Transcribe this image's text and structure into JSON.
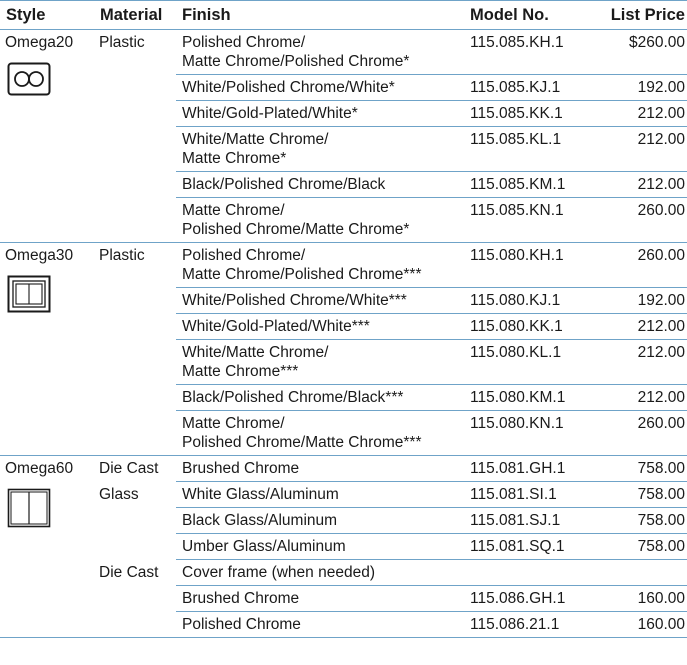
{
  "headers": {
    "style": "Style",
    "material": "Material",
    "finish": "Finish",
    "model": "Model No.",
    "price": "List Price"
  },
  "groups": [
    {
      "style": "Omega20",
      "icon": "omega20-two-circle-button-icon",
      "rows": [
        {
          "material": "Plastic",
          "finish": [
            "Polished Chrome/",
            "Matte Chrome/Polished Chrome*"
          ],
          "model": "115.085.KH.1",
          "price": "$260.00"
        },
        {
          "material": "",
          "finish": [
            "White/Polished Chrome/White*"
          ],
          "model": "115.085.KJ.1",
          "price": "192.00"
        },
        {
          "material": "",
          "finish": [
            "White/Gold-Plated/White*"
          ],
          "model": "115.085.KK.1",
          "price": "212.00"
        },
        {
          "material": "",
          "finish": [
            "White/Matte Chrome/",
            "Matte Chrome*"
          ],
          "model": "115.085.KL.1",
          "price": "212.00"
        },
        {
          "material": "",
          "finish": [
            "Black/Polished Chrome/Black"
          ],
          "model": "115.085.KM.1",
          "price": "212.00"
        },
        {
          "material": "",
          "finish": [
            "Matte Chrome/",
            "Polished Chrome/Matte Chrome*"
          ],
          "model": "115.085.KN.1",
          "price": "260.00"
        }
      ]
    },
    {
      "style": "Omega30",
      "icon": "omega30-dual-rectangle-button-icon",
      "rows": [
        {
          "material": "Plastic",
          "finish": [
            "Polished Chrome/",
            "Matte Chrome/Polished Chrome***"
          ],
          "model": "115.080.KH.1",
          "price": "260.00"
        },
        {
          "material": "",
          "finish": [
            "White/Polished Chrome/White***"
          ],
          "model": "115.080.KJ.1",
          "price": "192.00"
        },
        {
          "material": "",
          "finish": [
            "White/Gold-Plated/White***"
          ],
          "model": "115.080.KK.1",
          "price": "212.00"
        },
        {
          "material": "",
          "finish": [
            "White/Matte Chrome/",
            "Matte Chrome***"
          ],
          "model": "115.080.KL.1",
          "price": "212.00"
        },
        {
          "material": "",
          "finish": [
            "Black/Polished Chrome/Black***"
          ],
          "model": "115.080.KM.1",
          "price": "212.00"
        },
        {
          "material": "",
          "finish": [
            "Matte Chrome/",
            "Polished Chrome/Matte Chrome***"
          ],
          "model": "115.080.KN.1",
          "price": "260.00"
        }
      ]
    },
    {
      "style": "Omega60",
      "icon": "omega60-split-panel-icon",
      "rows": [
        {
          "material": "Die Cast",
          "finish": [
            "Brushed Chrome"
          ],
          "model": "115.081.GH.1",
          "price": "758.00"
        },
        {
          "material": "Glass",
          "finish": [
            "White Glass/Aluminum"
          ],
          "model": "115.081.SI.1",
          "price": "758.00"
        },
        {
          "material": "",
          "finish": [
            "Black Glass/Aluminum"
          ],
          "model": "115.081.SJ.1",
          "price": "758.00"
        },
        {
          "material": "",
          "finish": [
            "Umber Glass/Aluminum"
          ],
          "model": "115.081.SQ.1",
          "price": "758.00"
        },
        {
          "material": "Die Cast",
          "finish": [
            "Cover frame (when needed)"
          ],
          "model": "",
          "price": ""
        },
        {
          "material": "",
          "finish": [
            "Brushed Chrome"
          ],
          "model": "115.086.GH.1",
          "price": "160.00"
        },
        {
          "material": "",
          "finish": [
            "Polished Chrome"
          ],
          "model": "115.086.21.1",
          "price": "160.00"
        }
      ]
    }
  ],
  "colors": {
    "rule": "#6fa3c8",
    "text": "#1a1a1a"
  }
}
